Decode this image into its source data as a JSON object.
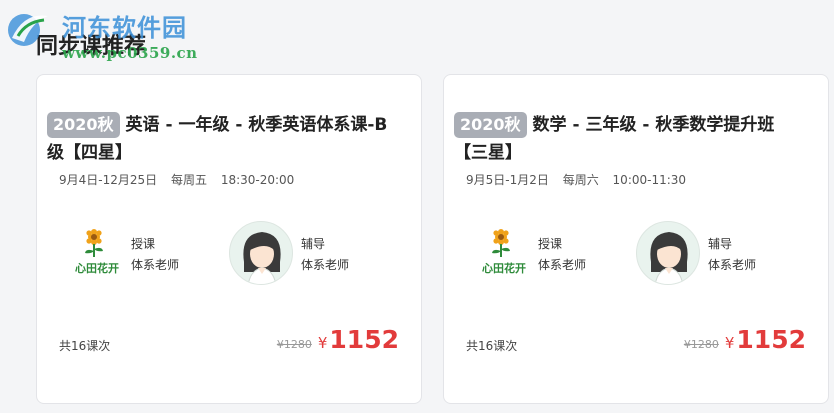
{
  "watermark": {
    "title": "河东软件园",
    "url": "www.pc0359.cn"
  },
  "section": {
    "title": "同步课推荐"
  },
  "cards": [
    {
      "tag": "2020秋",
      "title": "英语 - 一年级 - 秋季英语体系课-B级【四星】",
      "dates": "9月4日-12月25日",
      "weekday": "每周五",
      "time": "18:30-20:00",
      "teacher": {
        "role": "授课",
        "name": "体系老师",
        "logo_text": "心田花开"
      },
      "tutor": {
        "role": "辅导",
        "name": "体系老师"
      },
      "lessons": "共16课次",
      "original_price": "¥1280",
      "currency": "¥",
      "price": "1152"
    },
    {
      "tag": "2020秋",
      "title": "数学 - 三年级 - 秋季数学提升班【三星】",
      "dates": "9月5日-1月2日",
      "weekday": "每周六",
      "time": "10:00-11:30",
      "teacher": {
        "role": "授课",
        "name": "体系老师",
        "logo_text": "心田花开"
      },
      "tutor": {
        "role": "辅导",
        "name": "体系老师"
      },
      "lessons": "共16课次",
      "original_price": "¥1280",
      "currency": "¥",
      "price": "1152"
    }
  ],
  "colors": {
    "price": "#e23b3b",
    "tag_bg": "#a9adb5",
    "logo_green": "#2e8b3a",
    "logo_orange": "#f0a21a"
  }
}
